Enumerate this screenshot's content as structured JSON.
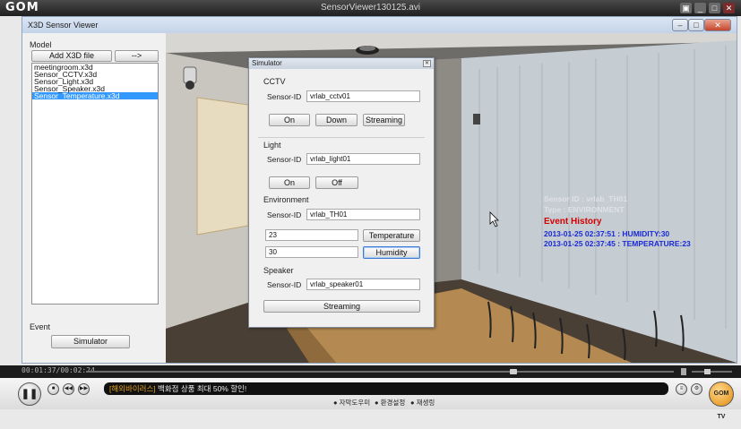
{
  "player": {
    "logo": "GOM",
    "file_title": "SensorViewer130125.avi",
    "timecode": "00:01:37/00:02:24",
    "playback_progress": 0.73,
    "ticker_tag": "[해외바이러스]",
    "ticker_text": "백화점 상품 최대 50% 할인!",
    "links": [
      "자막도우미",
      "환경설정",
      "재생링"
    ],
    "brand_badge": "GOM TV"
  },
  "window": {
    "title": "X3D Sensor Viewer",
    "controls": [
      "minimize-icon",
      "maximize-icon",
      "close-icon"
    ]
  },
  "left_panel": {
    "model_label": "Model",
    "add_button": "Add X3D file",
    "arrow_button": "-->",
    "files": [
      "meetingroom.x3d",
      "Sensor_CCTV.x3d",
      "Sensor_Light.x3d",
      "Sensor_Speaker.x3d",
      "Sensor_Temperature.x3d"
    ],
    "selected_index": 4,
    "event_label": "Event",
    "simulator_button": "Simulator"
  },
  "simulator": {
    "title": "Simulator",
    "sensor_id_label": "Sensor-ID",
    "cctv": {
      "label": "CCTV",
      "sensor_id": "vrlab_cctv01",
      "buttons": [
        "On",
        "Down",
        "Streaming"
      ]
    },
    "light": {
      "label": "Light",
      "sensor_id": "vrlab_light01",
      "buttons": [
        "On",
        "Off"
      ]
    },
    "environment": {
      "label": "Environment",
      "sensor_id": "vrlab_TH01",
      "temperature_value": "23",
      "temperature_button": "Temperature",
      "humidity_value": "30",
      "humidity_button": "Humidity"
    },
    "speaker": {
      "label": "Speaker",
      "sensor_id": "vrlab_speaker01",
      "button": "Streaming"
    }
  },
  "hud": {
    "line1": "Sensor ID : vrlab_TH01",
    "line2": "Type : ENVIRONMENT",
    "event_history_title": "Event History",
    "events": [
      "2013-01-25 02:37:51 : HUMIDITY:30",
      "2013-01-25 02:37:45 : TEMPERATURE:23"
    ]
  },
  "colors": {
    "selection": "#3399ff",
    "event_title": "#d30000",
    "event_text": "#1a2ad6"
  }
}
